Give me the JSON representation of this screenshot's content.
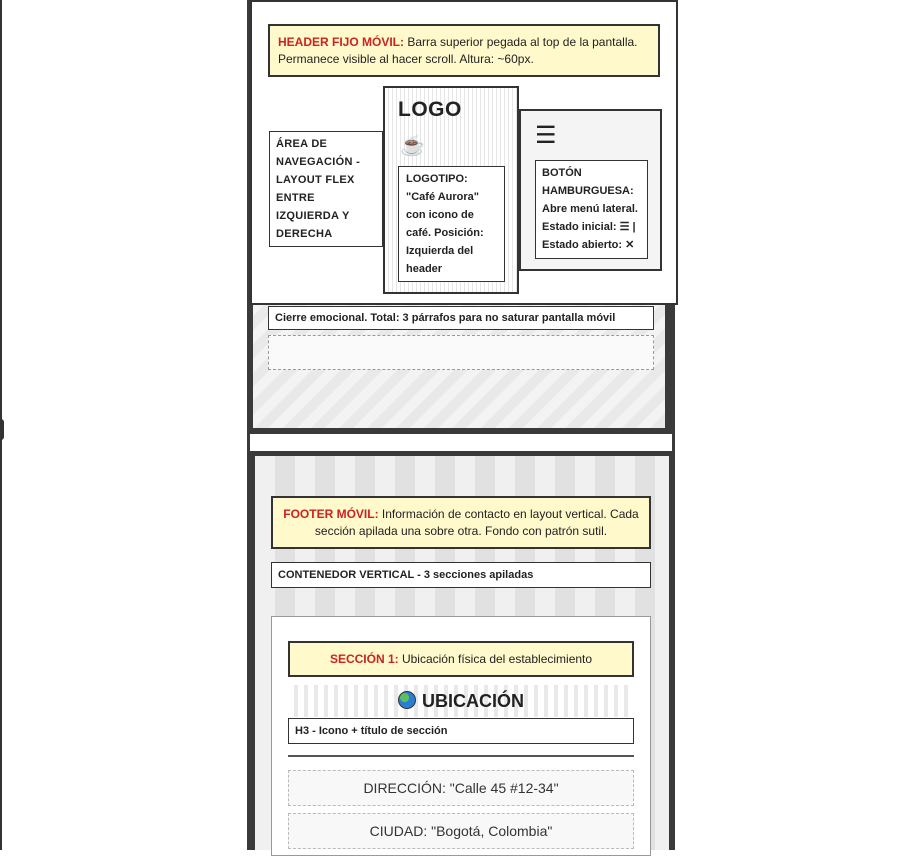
{
  "header": {
    "note_label": "HEADER FIJO MÓVIL:",
    "note_text": " Barra superior pegada al top de la pantalla. Permanece visible al hacer scroll. Altura: ~60px.",
    "nav_note": "ÁREA DE NAVEGACIÓN - LAYOUT FLEX ENTRE IZQUIERDA Y DERECHA",
    "logo": "LOGO",
    "logo_icon": "☕",
    "logo_note": "LOGOTIPO: \"Café Aurora\" con icono de café. Posición: Izquierda del header",
    "burger_icon": "☰",
    "burger_note": "BOTÓN HAMBURGUESA: Abre menú lateral. Estado inicial: ☰ | Estado abierto: ✕"
  },
  "middle": {
    "closing_note": "Cierre emocional. Total: 3 párrafos para no saturar pantalla móvil"
  },
  "footer": {
    "note_label": "FOOTER MÓVIL:",
    "note_text": " Información de contacto en layout vertical. Cada sección apilada una sobre otra. Fondo con patrón sutil.",
    "container_label": "CONTENEDOR VERTICAL - 3 secciones apiladas",
    "section1": {
      "note_label": "SECCIÓN 1:",
      "note_text": " Ubicación física del establecimiento",
      "title_icon": "globe-icon",
      "title": "UBICACIÓN",
      "h3_note": "H3 - Icono + título de sección",
      "address": "DIRECCIÓN: \"Calle 45 #12-34\"",
      "city": "CIUDAD: \"Bogotá, Colombia\""
    }
  }
}
